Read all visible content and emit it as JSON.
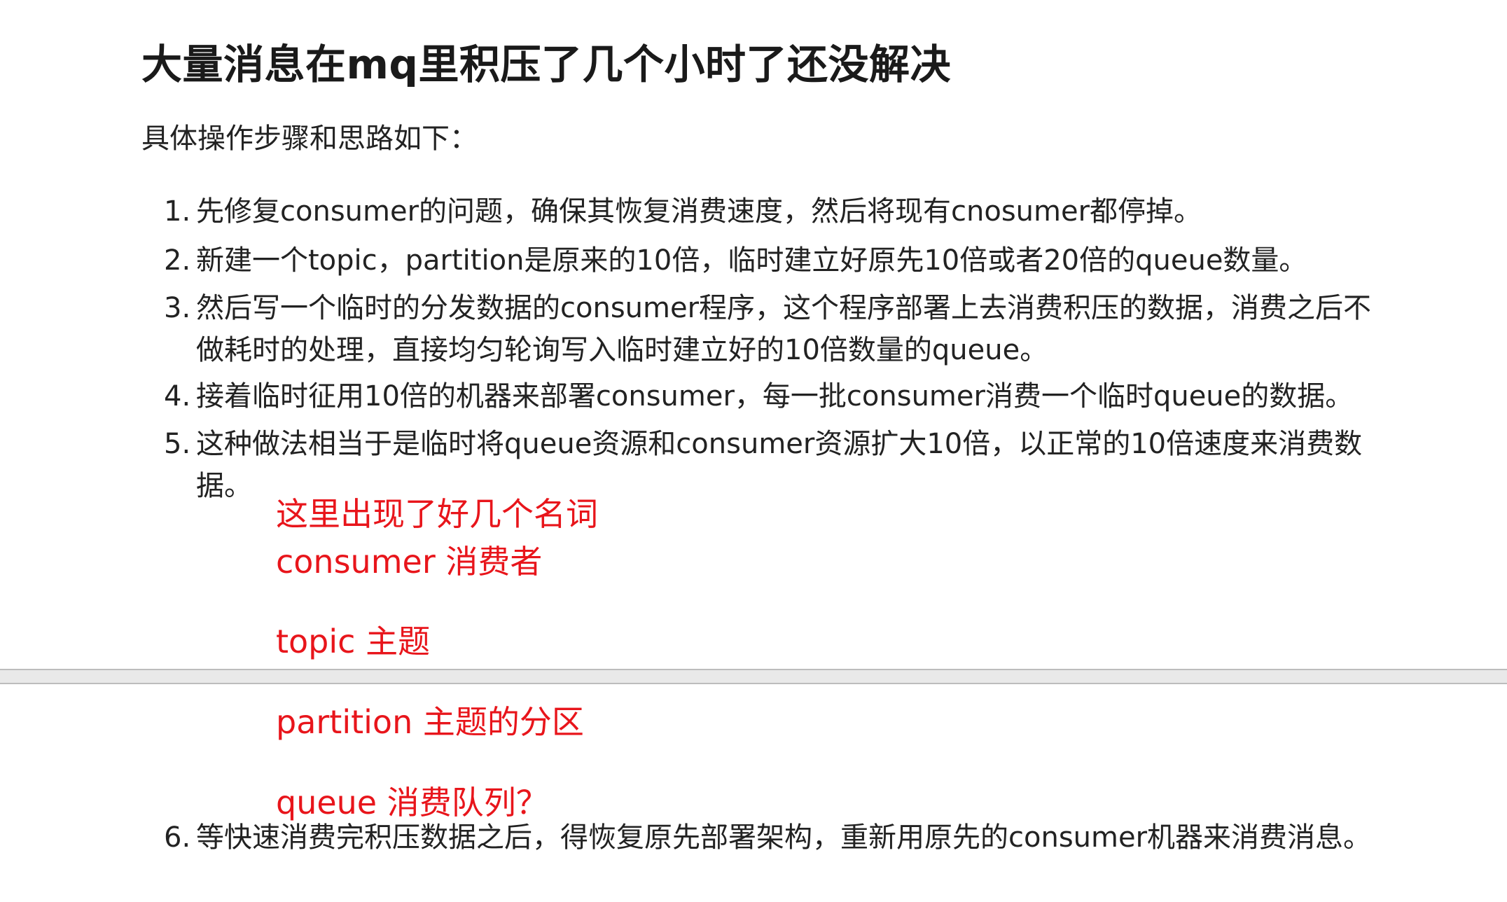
{
  "title": "大量消息在mq里积压了几个小时了还没解决",
  "intro": "具体操作步骤和思路如下：",
  "steps": [
    {
      "num": "1.",
      "line1": "先修复consumer的问题，确保其恢复消费速度，然后将现有cnosumer都停掉。",
      "line2": ""
    },
    {
      "num": "2.",
      "line1": "新建一个topic，partition是原来的10倍，临时建立好原先10倍或者20倍的queue数量。",
      "line2": ""
    },
    {
      "num": "3.",
      "line1": "然后写一个临时的分发数据的consumer程序，这个程序部署上去消费积压的数据，消费之后不",
      "line2": "做耗时的处理，直接均匀轮询写入临时建立好的10倍数量的queue。"
    },
    {
      "num": "4.",
      "line1": "接着临时征用10倍的机器来部署consumer，每一批consumer消费一个临时queue的数据。",
      "line2": ""
    },
    {
      "num": "5.",
      "line1": "这种做法相当于是临时将queue资源和consumer资源扩大10倍，以正常的10倍速度来消费数",
      "line2": "据。"
    },
    {
      "num": "6.",
      "line1": "等快速消费完积压数据之后，得恢复原先部署架构，重新用原先的consumer机器来消费消息。",
      "line2": ""
    }
  ],
  "notes": {
    "heading": "这里出现了好几个名词",
    "consumer": "consumer 消费者",
    "topic": "topic 主题",
    "partition": "partition 主题的分区",
    "queue": "queue 消费队列？"
  },
  "colors": {
    "note_red": "#e8151b",
    "text": "#222222",
    "divider": "#bdbdbd"
  }
}
